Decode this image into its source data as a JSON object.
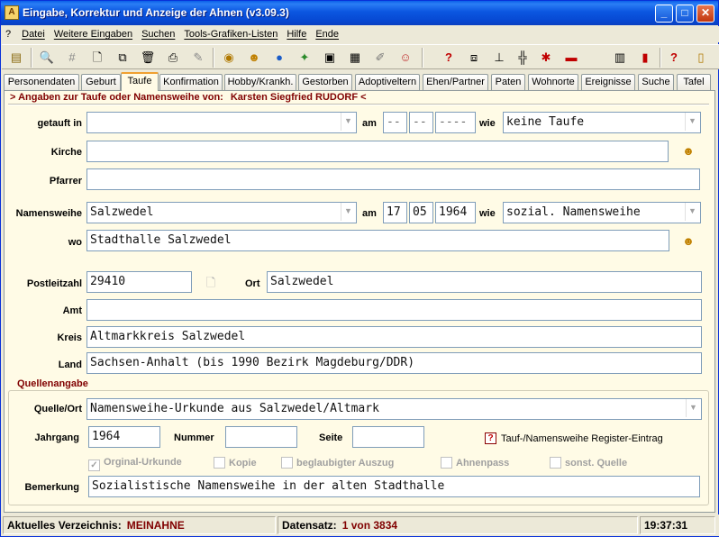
{
  "window": {
    "title": "Eingabe, Korrektur und Anzeige der Ahnen (v3.09.3)"
  },
  "menu": [
    "?",
    "Datei",
    "Weitere Eingaben",
    "Suchen",
    "Tools-Grafiken-Listen",
    "Hilfe",
    "Ende"
  ],
  "toolbar_icons": [
    "book-icon",
    "search-doc-icon",
    "hash-icon",
    "new-doc-icon",
    "copy-doc-icon",
    "trash-icon",
    "print-doc-icon",
    "edit-doc-icon",
    "timer-icon",
    "smiley-icon",
    "globe-icon",
    "walker-icon",
    "camera-icon",
    "note-icon",
    "pen-icon",
    "people-icon",
    "help-search-icon",
    "documents-icon",
    "tree-icon",
    "network-icon",
    "sparkle-icon",
    "car-icon",
    "page-icon",
    "chart-icon",
    "help-icon",
    "exit-door-icon"
  ],
  "tabs": [
    "Personendaten",
    "Geburt",
    "Taufe",
    "Konfirmation",
    "Hobby/Krankh.",
    "Gestorben",
    "Adoptiveltern",
    "Ehen/Partner",
    "Paten",
    "Wohnorte",
    "Ereignisse",
    "Suche",
    "Tafel"
  ],
  "heading": {
    "prefix": "> Angaben zur Taufe oder Namensweihe von:",
    "name": "Karsten Siegfried RUDORF",
    "suffix": "<"
  },
  "form": {
    "getauft_label": "getauft in",
    "getauft_value": "",
    "am_label": "am",
    "taufe_day": "--",
    "taufe_month": "--",
    "taufe_year": "----",
    "wie_label": "wie",
    "taufe_wie": "keine Taufe",
    "kirche_label": "Kirche",
    "kirche_value": "",
    "pfarrer_label": "Pfarrer",
    "pfarrer_value": "",
    "namensweihe_label": "Namensweihe",
    "namensweihe_value": "Salzwedel",
    "nw_day": "17",
    "nw_month": "05",
    "nw_year": "1964",
    "nw_wie": "sozial. Namensweihe",
    "wo_label": "wo",
    "wo_value": "Stadthalle Salzwedel",
    "plz_label": "Postleitzahl",
    "plz_value": "29410",
    "ort_label": "Ort",
    "ort_value": "Salzwedel",
    "amt_label": "Amt",
    "amt_value": "",
    "kreis_label": "Kreis",
    "kreis_value": "Altmarkkreis Salzwedel",
    "land_label": "Land",
    "land_value": "Sachsen-Anhalt (bis 1990 Bezirk Magdeburg/DDR)"
  },
  "quellen": {
    "title": "Quellenangabe",
    "quelle_label": "Quelle/Ort",
    "quelle_value": "Namensweihe-Urkunde aus Salzwedel/Altmark",
    "jahrgang_label": "Jahrgang",
    "jahrgang_value": "1964",
    "nummer_label": "Nummer",
    "nummer_value": "",
    "seite_label": "Seite",
    "seite_value": "",
    "register_label": "Tauf-/Namensweihe Register-Eintrag",
    "checkboxes": [
      {
        "label": "Orginal-Urkunde",
        "checked": true
      },
      {
        "label": "Kopie",
        "checked": false
      },
      {
        "label": "beglaubigter Auszug",
        "checked": false
      },
      {
        "label": "Ahnenpass",
        "checked": false
      },
      {
        "label": "sonst. Quelle",
        "checked": false
      }
    ],
    "bemerkung_label": "Bemerkung",
    "bemerkung_value": "Sozialistische Namensweihe in der alten Stadthalle"
  },
  "status": {
    "verzeichnis_label": "Aktuelles Verzeichnis:",
    "verzeichnis_value": "MEINAHNE",
    "datensatz_label": "Datensatz:",
    "datensatz_value": "1 von 3834",
    "time": "19:37:31"
  },
  "colors": {
    "accent": "#800000",
    "titlebar": "#0a5fe8",
    "panel": "#fffbe6"
  }
}
